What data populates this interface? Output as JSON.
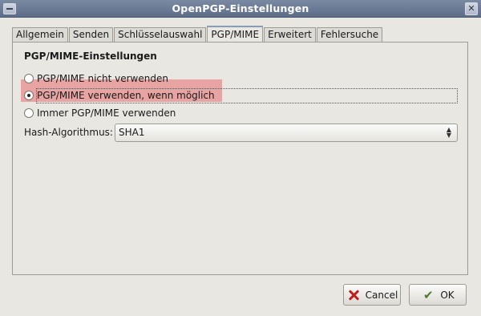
{
  "window": {
    "title": "OpenPGP-Einstellungen",
    "close_glyph": "✕"
  },
  "tabs": [
    {
      "label": "Allgemein"
    },
    {
      "label": "Senden"
    },
    {
      "label": "Schlüsselauswahl"
    },
    {
      "label": "PGP/MIME",
      "active": true
    },
    {
      "label": "Erweitert"
    },
    {
      "label": "Fehlersuche"
    }
  ],
  "pgpmime": {
    "section_title": "PGP/MIME-Einstellungen",
    "options": [
      {
        "label": "PGP/MIME nicht verwenden",
        "checked": false
      },
      {
        "label": "PGP/MIME verwenden, wenn möglich",
        "checked": true
      },
      {
        "label": "Immer PGP/MIME verwenden",
        "checked": false
      }
    ],
    "hash_label": "Hash-Algorithmus:",
    "hash_value": "SHA1"
  },
  "buttons": {
    "cancel": "Cancel",
    "ok": "OK"
  },
  "colors": {
    "titlebar": "#6b7a95",
    "highlight": "#e66e6e",
    "background": "#e8e7e2"
  },
  "icons": {
    "cancel": "cancel-icon",
    "ok": "ok-icon",
    "window_menu": "window-menu-icon",
    "close": "close-icon",
    "select_arrows": "select-arrows-icon"
  }
}
